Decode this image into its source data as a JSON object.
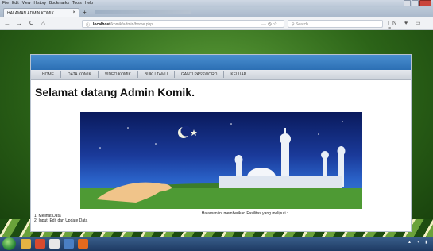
{
  "window": {
    "menu": [
      "File",
      "Edit",
      "View",
      "History",
      "Bookmarks",
      "Tools",
      "Help"
    ]
  },
  "tab": {
    "title": "HALAMAN ADMIN KOMIK",
    "close_glyph": "×",
    "new_tab_glyph": "+"
  },
  "nav": {
    "back": "←",
    "forward": "→",
    "reload": "C",
    "home": "⌂",
    "url_host": "localhost",
    "url_path": "/komik/admin/home.php",
    "url_icons": "··· ◎ ☆",
    "search_placeholder": "Search",
    "right_icons": "IN ♥ ▭ ≡"
  },
  "page": {
    "menu": [
      "HOME",
      "DATA KOMIK",
      "VIDEO KOMIK",
      "BUKU TAMU",
      "GANTI PASSWORD",
      "KELUAR"
    ],
    "welcome": "Selamat datang Admin Komik.",
    "caption": "Halaman ini memberikan Fasilitas yang meliputi :",
    "list": [
      "1. Melihat Data",
      "2. Input, Edit dan Update Data"
    ]
  },
  "colors": {
    "banner": "#2c6fb4",
    "page_bg": "#2f6e1c"
  }
}
